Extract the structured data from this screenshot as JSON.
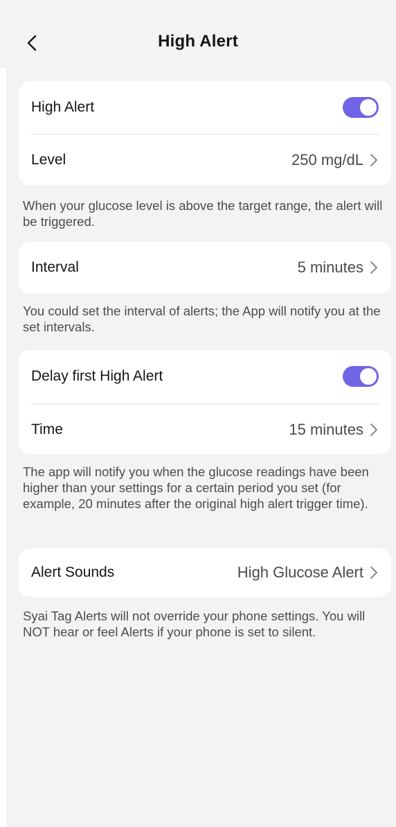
{
  "header": {
    "title": "High Alert",
    "back_icon": "chevron-left-icon"
  },
  "accent_color": "#7064e6",
  "alert_card": {
    "enable_label": "High Alert",
    "enable_on": true,
    "level_label": "Level",
    "level_value": "250 mg/dL"
  },
  "alert_note": "When your glucose level is above the target range, the alert will be triggered.",
  "interval_card": {
    "label": "Interval",
    "value": "5 minutes"
  },
  "interval_note": "You could set the interval of alerts; the App will notify you at the set intervals.",
  "delay_card": {
    "enable_label": "Delay first High Alert",
    "enable_on": true,
    "time_label": "Time",
    "time_value": "15 minutes"
  },
  "delay_note": "The app will notify you when the glucose readings have been higher than your settings for a certain period you set (for example, 20 minutes after the original high alert trigger time).",
  "sounds_card": {
    "label": "Alert Sounds",
    "value": "High Glucose Alert"
  },
  "sounds_note": "Syai Tag Alerts will not override your phone settings. You will NOT hear or feel Alerts if your phone is set to silent."
}
